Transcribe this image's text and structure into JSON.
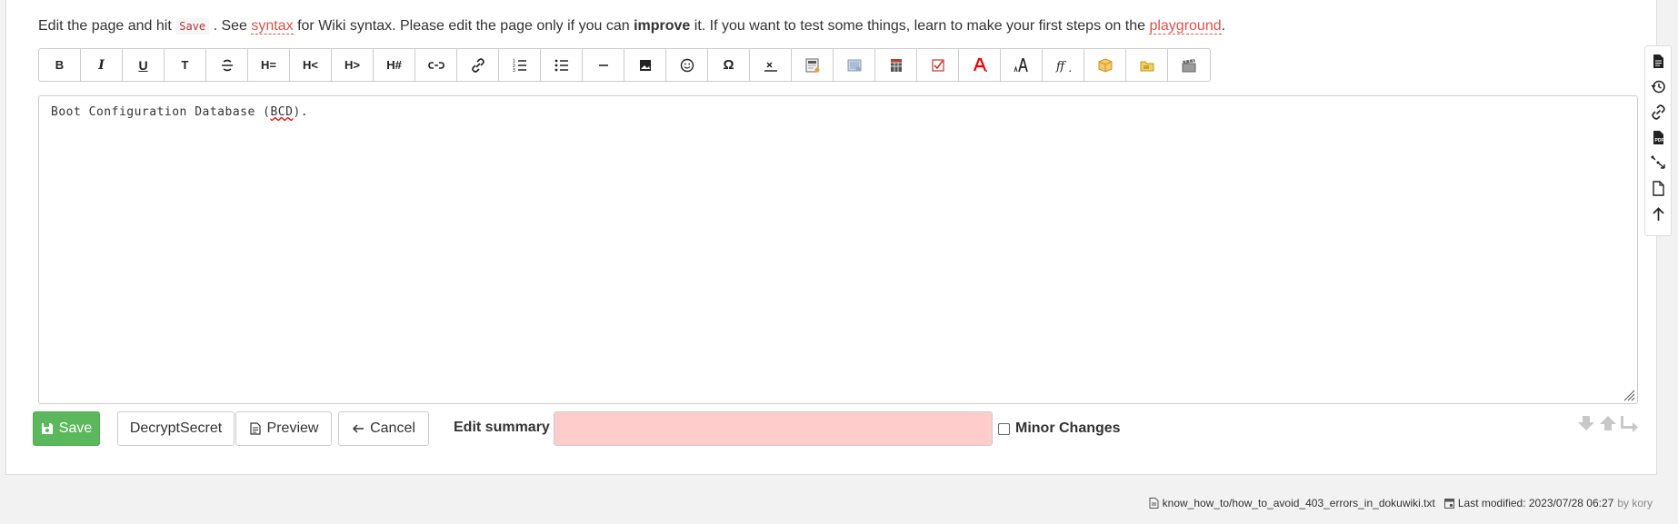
{
  "intro": {
    "part1": "Edit the page and hit ",
    "save_code": "Save",
    "part2": " . See ",
    "syntax_link": "syntax",
    "part3": " for Wiki syntax. Please edit the page only if you can ",
    "improve": "improve",
    "part4": " it. If you want to test some things, learn to make your first steps on the ",
    "playground_link": "playground",
    "part5": "."
  },
  "toolbar": {
    "bold": "B",
    "italic": "I",
    "underline": "U",
    "code": "T",
    "h_same": "H=",
    "h_higher": "H<",
    "h_lower": "H>",
    "h_select": "H#",
    "omega": "Ω"
  },
  "editor": {
    "text_before": "Boot Configuration Database (",
    "text_spell": "BCD",
    "text_after": ")."
  },
  "actions": {
    "save": "Save",
    "decrypt": "DecryptSecret",
    "preview": "Preview",
    "cancel": "Cancel",
    "summary_label": "Edit summary",
    "summary_value": "",
    "minor_label": "Minor Changes"
  },
  "footer": {
    "file": "know_how_to/how_to_avoid_403_errors_in_dokuwiki.txt",
    "modified": "Last modified: 2023/07/28 06:27",
    "by": "by kory"
  },
  "colors": {
    "save": "#5cb85c",
    "link": "#d9534f",
    "summary_bg": "#ffcccc"
  }
}
